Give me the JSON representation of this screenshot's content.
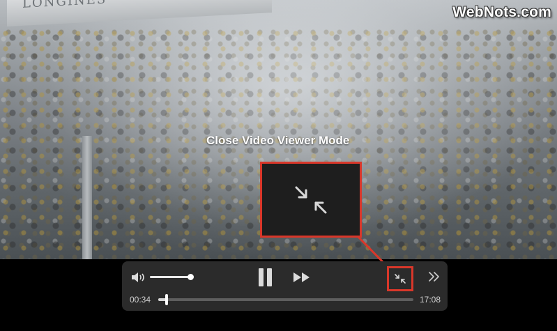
{
  "watermark": "WebNots.com",
  "video": {
    "banner_text": "LONGINES"
  },
  "annotation": {
    "label": "Close Video Viewer Mode",
    "highlight_color": "#d9372a"
  },
  "controls": {
    "volume_level": 1.0,
    "time_elapsed": "00:34",
    "time_total": "17:08",
    "progress_fraction": 0.033,
    "icons": {
      "volume": "speaker-volume-icon",
      "pause": "pause-icon",
      "fast_forward": "fast-forward-icon",
      "exit_viewer": "exit-viewer-mode-icon",
      "more": "chevron-double-right-icon"
    }
  }
}
